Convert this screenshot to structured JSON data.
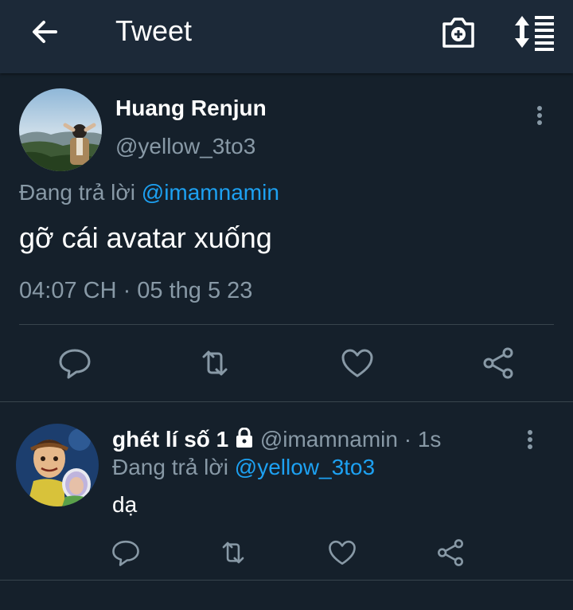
{
  "header": {
    "title": "Tweet",
    "back_icon": "arrow-left-icon",
    "camera_icon": "camera-add-icon",
    "sort_icon": "sort-list-icon"
  },
  "main_tweet": {
    "name": "Huang Renjun",
    "handle": "@yellow_3to3",
    "reply_prefix": "Đang trả lời",
    "reply_to": "@imamnamin",
    "text": "gỡ cái avatar xuống",
    "timestamp": "04:07 CH · 05 thg 5 23"
  },
  "reply_tweet": {
    "name": "ghét lí số 1",
    "handle_time": "@imamnamin · 1s",
    "reply_prefix": "Đang trả lời",
    "reply_to": "@yellow_3to3",
    "text": "dạ"
  },
  "colors": {
    "background": "#15202b",
    "header": "#1c2938",
    "accent": "#1da1f2",
    "secondary_text": "#8899a6",
    "divider": "#38444d"
  }
}
